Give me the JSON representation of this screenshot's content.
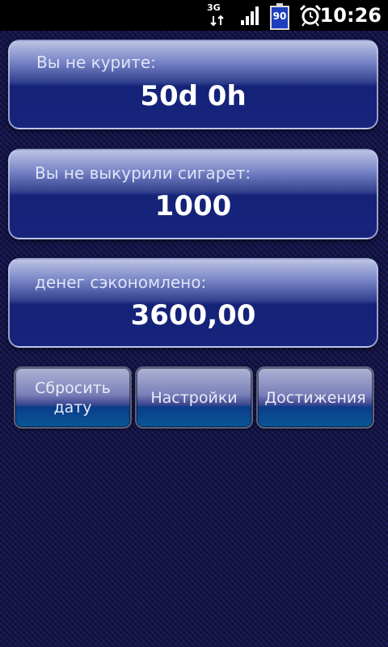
{
  "status_bar": {
    "network": "3G",
    "battery": "90",
    "time": "10:26"
  },
  "cards": [
    {
      "label": "Вы не курите:",
      "value": "50d 0h"
    },
    {
      "label": "Вы не выкурили сигарет:",
      "value": "1000"
    },
    {
      "label": "денег сэкономлено:",
      "value": "3600,00"
    }
  ],
  "buttons": {
    "reset_line1": "Сбросить",
    "reset_line2": "дату",
    "settings": "Настройки",
    "achievements": "Достижения"
  },
  "colors": {
    "background": "#12124a",
    "card_dark": "#142278",
    "button_bottom": "#095796"
  },
  "icons": {
    "network": "network-3g-icon",
    "signal": "signal-strength-icon",
    "battery": "battery-icon",
    "alarm": "alarm-clock-icon"
  }
}
